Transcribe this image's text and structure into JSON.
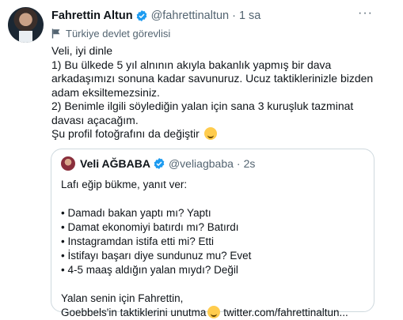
{
  "tweet": {
    "author_name": "Fahrettin Altun",
    "handle": "@fahrettinaltun",
    "separator": "·",
    "time": "1 sa",
    "more": "···",
    "label": "Türkiye devlet görevlisi",
    "lines": [
      "Veli, iyi dinle",
      "1) Bu ülkede 5 yıl alnının akıyla bakanlık yapmış bir dava",
      "arkadaşımızı sonuna kadar savunuruz. Ucuz taktiklerinizle bizden",
      "adam eksiltemezsiniz.",
      "2) Benimle ilgili söylediğin yalan için sana 3 kuruşluk tazminat",
      "davası açacağım.",
      "Şu profil fotoğrafını da değiştir"
    ]
  },
  "quote": {
    "author_name": "Veli AĞBABA",
    "handle": "@veliagbaba",
    "separator": "·",
    "time": "2s",
    "intro": "Lafı eğip bükme, yanıt ver:",
    "bullets": [
      "• Damadı bakan yaptı mı? Yaptı",
      "• Damat ekonomiyi batırdı mı? Batırdı",
      "• Instagramdan istifa etti mi? Etti",
      "• İstifayı başarı diye sundunuz mu? Evet",
      "• 4-5 maaş aldığın yalan mıydı? Değil"
    ],
    "outro_1": "Yalan senin için Fahrettin,",
    "outro_2_start": "Goebbels'in taktiklerini unutma",
    "outro_2_link": " twitter.com/fahrettinaltun..."
  },
  "colors": {
    "verified": "#1d9bf0",
    "secondary_text": "#536471",
    "border": "#cfd9de"
  },
  "icons": [
    "avatar",
    "verified-badge-icon",
    "flag-icon",
    "more-icon",
    "emoji-icon"
  ]
}
